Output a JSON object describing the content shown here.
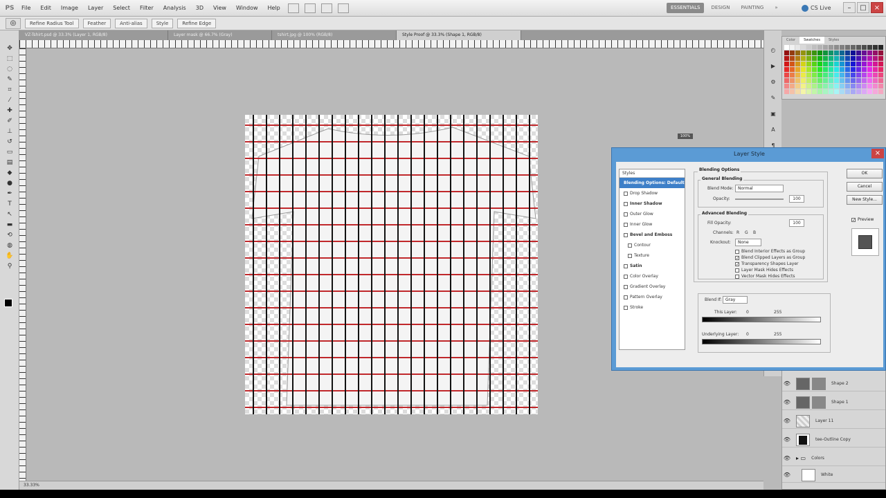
{
  "app": {
    "logo": "PS",
    "menu": [
      "File",
      "Edit",
      "Image",
      "Layer",
      "Select",
      "Filter",
      "Analysis",
      "3D",
      "View",
      "Window",
      "Help"
    ],
    "workspaces": [
      "ESSENTIALS",
      "DESIGN",
      "PAINTING"
    ],
    "cs_live": "CS Live"
  },
  "options": {
    "buttons": [
      "Refine Radius Tool",
      "Feather",
      "Anti-alias",
      "Style",
      "Refine Edge"
    ]
  },
  "doc_tabs": [
    "VZ-Tshirt.psd @ 33.3% (Layer 1, RGB/8)",
    "Layer mask @ 66.7% (Gray)",
    "tshirt.jpg @ 100% (RGB/8)",
    "Style Proof @ 33.3% (Shape 1, RGB/8)"
  ],
  "status": "33.33%",
  "styles_dialog": {
    "title": "Layer Style",
    "styles_header": "Styles",
    "style_items": [
      {
        "label": "Blending Options: Default",
        "selected": true,
        "checkbox": false,
        "bold": true,
        "indent": false
      },
      {
        "label": "Drop Shadow",
        "selected": false,
        "checkbox": true,
        "bold": false,
        "indent": false
      },
      {
        "label": "Inner Shadow",
        "selected": false,
        "checkbox": true,
        "bold": true,
        "indent": false
      },
      {
        "label": "Outer Glow",
        "selected": false,
        "checkbox": true,
        "bold": false,
        "indent": false
      },
      {
        "label": "Inner Glow",
        "selected": false,
        "checkbox": true,
        "bold": false,
        "indent": false
      },
      {
        "label": "Bevel and Emboss",
        "selected": false,
        "checkbox": true,
        "bold": true,
        "indent": false
      },
      {
        "label": "Contour",
        "selected": false,
        "checkbox": true,
        "bold": false,
        "indent": true
      },
      {
        "label": "Texture",
        "selected": false,
        "checkbox": true,
        "bold": false,
        "indent": true
      },
      {
        "label": "Satin",
        "selected": false,
        "checkbox": true,
        "bold": true,
        "indent": false
      },
      {
        "label": "Color Overlay",
        "selected": false,
        "checkbox": true,
        "bold": false,
        "indent": false
      },
      {
        "label": "Gradient Overlay",
        "selected": false,
        "checkbox": true,
        "bold": false,
        "indent": false
      },
      {
        "label": "Pattern Overlay",
        "selected": false,
        "checkbox": true,
        "bold": false,
        "indent": false
      },
      {
        "label": "Stroke",
        "selected": false,
        "checkbox": true,
        "bold": false,
        "indent": false
      }
    ],
    "blending": {
      "section_title": "Blending Options",
      "general_title": "General Blending",
      "blend_mode_label": "Blend Mode:",
      "blend_mode_value": "Normal",
      "opacity_label": "Opacity:",
      "opacity_value": "100",
      "advanced_title": "Advanced Blending",
      "fill_label": "Fill Opacity:",
      "fill_value": "100",
      "channels_label": "Channels:",
      "channels": [
        "R",
        "G",
        "B"
      ],
      "knockout_label": "Knockout:",
      "knockout_value": "None",
      "checks": [
        {
          "label": "Blend Interior Effects as Group",
          "checked": false
        },
        {
          "label": "Blend Clipped Layers as Group",
          "checked": true
        },
        {
          "label": "Transparency Shapes Layer",
          "checked": true
        },
        {
          "label": "Layer Mask Hides Effects",
          "checked": false
        },
        {
          "label": "Vector Mask Hides Effects",
          "checked": false
        }
      ]
    },
    "blend_if": {
      "label": "Blend If:",
      "value": "Gray",
      "this_layer_label": "This Layer:",
      "this_layer_min": "0",
      "this_layer_max": "255",
      "underlying_label": "Underlying Layer:",
      "underlying_min": "0",
      "underlying_max": "255"
    },
    "buttons": {
      "ok": "OK",
      "cancel": "Cancel",
      "new_style": "New Style...",
      "preview": "Preview"
    }
  },
  "swatches": {
    "tabs": [
      "Color",
      "Swatches",
      "Styles"
    ]
  },
  "layers": [
    {
      "name": "Shape 2",
      "thumb": "dark-mask"
    },
    {
      "name": "Shape 1",
      "thumb": "dark-mask"
    },
    {
      "name": "Layer 11",
      "thumb": "check"
    },
    {
      "name": "tee-Outline Copy",
      "thumb": "shirt"
    },
    {
      "name": "Colors",
      "thumb": "folder"
    },
    {
      "name": "White",
      "thumb": "white"
    }
  ],
  "tooltip": "100%"
}
